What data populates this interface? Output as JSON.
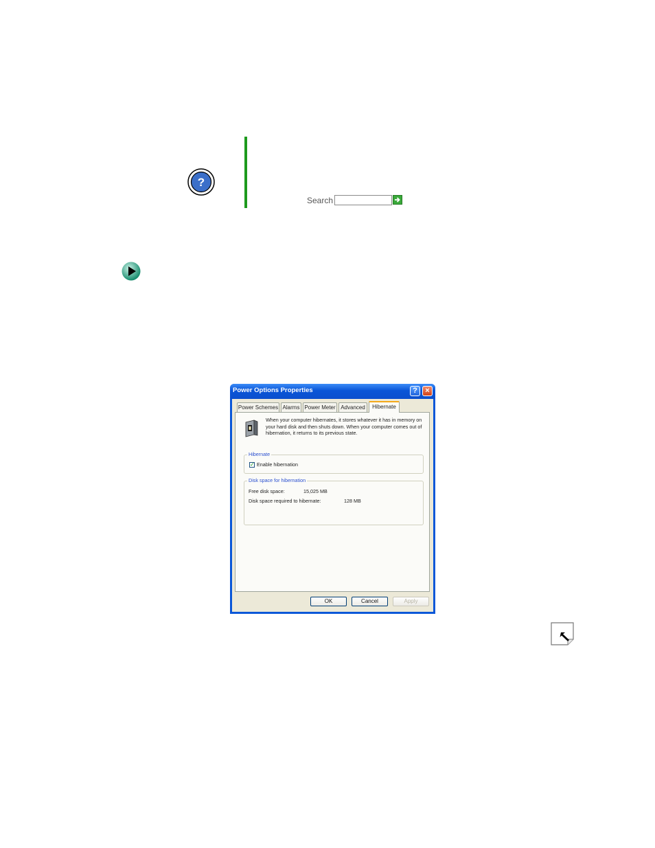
{
  "help": {
    "search_label": "Search",
    "search_value": ""
  },
  "dialog": {
    "title": "Power Options Properties",
    "help_button": "?",
    "close_button": "×",
    "tabs": [
      {
        "label": "Power Schemes",
        "active": false
      },
      {
        "label": "Alarms",
        "active": false
      },
      {
        "label": "Power Meter",
        "active": false
      },
      {
        "label": "Advanced",
        "active": false
      },
      {
        "label": "Hibernate",
        "active": true
      }
    ],
    "description": "When your computer hibernates, it stores whatever it has in memory on your hard disk and then shuts down. When your computer comes out of hibernation, it returns to its previous state.",
    "hibernate_group": {
      "label": "Hibernate",
      "checkbox_label": "Enable hibernation",
      "checked": true
    },
    "disk_group": {
      "label": "Disk space for hibernation",
      "free_label": "Free disk space:",
      "free_value": "15,025 MB",
      "required_label": "Disk space required to hibernate:",
      "required_value": "128 MB"
    },
    "buttons": {
      "ok": "OK",
      "cancel": "Cancel",
      "apply": "Apply"
    }
  },
  "colors": {
    "accent_green": "#1e9a1e",
    "xp_blue": "#0a57d8",
    "group_label_blue": "#2a4fcf"
  },
  "icons": [
    "help-question-icon",
    "search-go-arrow-icon",
    "procedure-arrow-icon",
    "hibernate-computer-icon",
    "page-turn-icon"
  ]
}
